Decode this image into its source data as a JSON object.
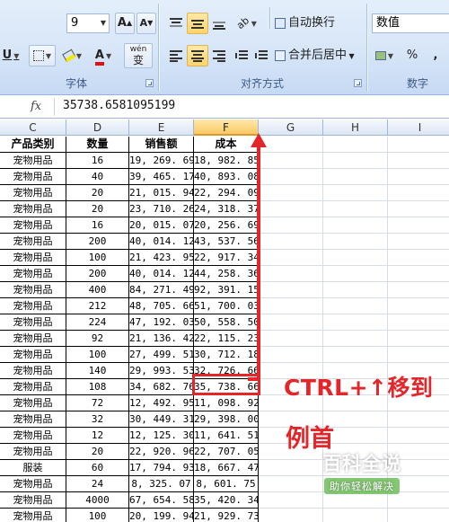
{
  "ribbon": {
    "font_size_value": "9",
    "grow_font": "A",
    "shrink_font": "A",
    "underline": "U",
    "font_color_letter": "A",
    "phonetic": "wén",
    "phonetic_char": "变",
    "wrap_text_label": "自动换行",
    "merge_center_label": "合并后居中",
    "number_format_value": "数值",
    "percent": "%",
    "comma": ",",
    "group_font": "字体",
    "group_alignment": "对齐方式",
    "group_number": "数字"
  },
  "formula_bar": {
    "fx": "fx",
    "value": "35738.6581095199"
  },
  "columns": [
    "C",
    "D",
    "E",
    "F",
    "G",
    "H",
    "I"
  ],
  "selected_column": "F",
  "table": {
    "headers": [
      "产品类别",
      "数量",
      "销售额",
      "成本"
    ],
    "rows": [
      [
        "宠物用品",
        "16",
        "19, 269. 69",
        "18, 982. 85"
      ],
      [
        "宠物用品",
        "40",
        "39, 465. 17",
        "40, 893. 08"
      ],
      [
        "宠物用品",
        "20",
        "21, 015. 94",
        "22, 294. 09"
      ],
      [
        "宠物用品",
        "20",
        "23, 710. 26",
        "24, 318. 37"
      ],
      [
        "宠物用品",
        "16",
        "20, 015. 07",
        "20, 256. 69"
      ],
      [
        "宠物用品",
        "200",
        "40, 014. 12",
        "43, 537. 56"
      ],
      [
        "宠物用品",
        "100",
        "21, 423. 95",
        "22, 917. 34"
      ],
      [
        "宠物用品",
        "200",
        "40, 014. 12",
        "44, 258. 36"
      ],
      [
        "宠物用品",
        "400",
        "84, 271. 49",
        "92, 391. 15"
      ],
      [
        "宠物用品",
        "212",
        "48, 705. 66",
        "51, 700. 03"
      ],
      [
        "宠物用品",
        "224",
        "47, 192. 03",
        "50, 558. 50"
      ],
      [
        "宠物用品",
        "92",
        "21, 136. 42",
        "22, 115. 23"
      ],
      [
        "宠物用品",
        "100",
        "27, 499. 51",
        "30, 712. 18"
      ],
      [
        "宠物用品",
        "140",
        "29, 993. 53",
        "32, 726. 66"
      ],
      [
        "宠物用品",
        "108",
        "34, 682. 76",
        "35, 738. 66"
      ],
      [
        "宠物用品",
        "72",
        "12, 492. 95",
        "11, 098. 92"
      ],
      [
        "宠物用品",
        "32",
        "30, 449. 31",
        "29, 398. 00"
      ],
      [
        "宠物用品",
        "12",
        "12, 125. 30",
        "11, 641. 51"
      ],
      [
        "宠物用品",
        "20",
        "22, 920. 96",
        "22, 707. 05"
      ],
      [
        "服装",
        "60",
        "17, 794. 93",
        "18, 667. 47"
      ],
      [
        "宠物用品",
        "24",
        "8, 325. 07",
        "8, 601. 75"
      ],
      [
        "宠物用品",
        "4000",
        "67, 654. 58",
        "35, 420. 34"
      ],
      [
        "宠物用品",
        "100",
        "20, 199. 94",
        "21, 929. 73"
      ]
    ]
  },
  "annotation": {
    "line1": "CTRL+↑移到",
    "line2": "例首"
  },
  "watermark": {
    "main": "百科全说",
    "sub": "助你轻松解决"
  },
  "colors": {
    "annotation_red": "#e3262a",
    "selected_header": "#f9c964",
    "ribbon_bg": "#d7e6f8"
  }
}
